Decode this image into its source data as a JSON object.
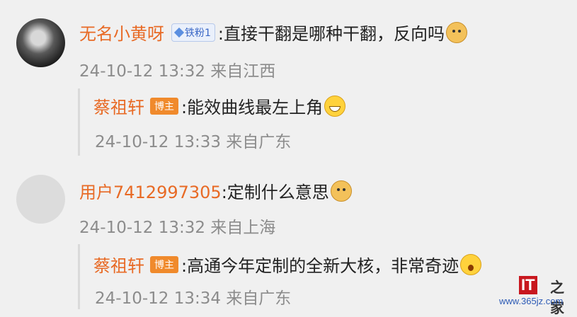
{
  "comments": [
    {
      "username": "无名小黄呀",
      "fan_badge": "铁粉1",
      "text": ":直接干翻是哪种干翻，反向吗",
      "emoji": "doge-emoji",
      "timestamp": "24-10-12 13:32 来自江西",
      "reply": {
        "username": "蔡祖轩",
        "badge": "博主",
        "text": ":能效曲线最左上角",
        "emoji": "grin-emoji",
        "timestamp": "24-10-12 13:33 来自广东"
      }
    },
    {
      "username": "用户7412997305",
      "text": ":定制什么意思",
      "emoji": "doge-emoji",
      "timestamp": "24-10-12 13:32 来自上海",
      "reply": {
        "username": "蔡祖轩",
        "badge": "博主",
        "text": ":高通今年定制的全新大核，非常奇迹",
        "emoji": "wow-emoji",
        "timestamp": "24-10-12 13:34 来自广东"
      }
    }
  ],
  "watermark": {
    "logo": "IT",
    "logo_zh": "之家",
    "url": "www.365jz.com"
  },
  "colors": {
    "username": "#e86a25",
    "host_badge": "#f08a2c",
    "timestamp": "#8c8c8c",
    "background": "#f0f0f0"
  }
}
